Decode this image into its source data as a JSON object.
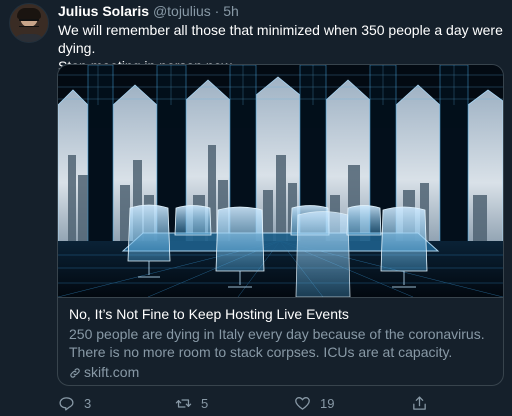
{
  "tweet": {
    "author_name": "Julius Solaris",
    "handle": "@tojulius",
    "separator": "·",
    "time": "5h",
    "text_line1": "We will remember all those that minimized when 350 people a day were dying.",
    "text_line2": "Stop meeting in person now."
  },
  "card": {
    "title": "No, It’s Not Fine to Keep Hosting Live Events",
    "description": "250 people are dying in Italy every day because of the coronavirus. There is no more room to stack corpses. ICUs are at capacity.",
    "domain": "skift.com"
  },
  "actions": {
    "reply_count": "3",
    "retweet_count": "5",
    "like_count": "19"
  },
  "icons": {
    "reply": "reply-icon",
    "retweet": "retweet-icon",
    "like": "heart-icon",
    "share": "share-icon",
    "link": "link-icon"
  },
  "colors": {
    "background": "#15202b",
    "border": "#38444d",
    "secondary_text": "#8899a6",
    "primary_text": "#ffffff"
  }
}
